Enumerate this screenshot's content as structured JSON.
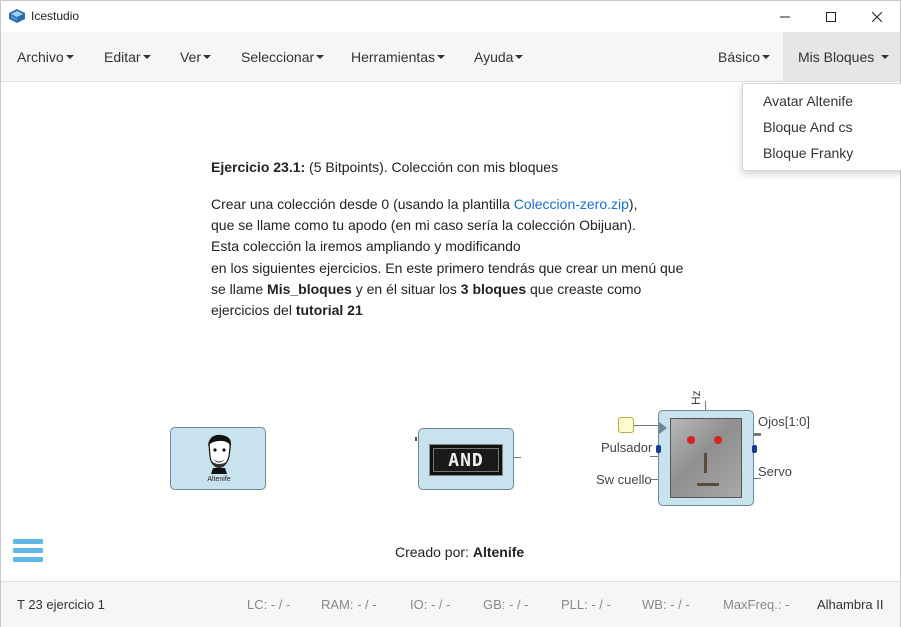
{
  "window": {
    "title": "Icestudio",
    "icon": "icestudio-logo-icon"
  },
  "menubar": {
    "items": [
      {
        "label": "Archivo"
      },
      {
        "label": "Editar"
      },
      {
        "label": "Ver"
      },
      {
        "label": "Seleccionar"
      },
      {
        "label": "Herramientas"
      },
      {
        "label": "Ayuda"
      }
    ],
    "right_items": [
      {
        "label": "Básico"
      },
      {
        "label": "Mis Bloques"
      }
    ]
  },
  "dropdown": {
    "items": [
      {
        "label": "Avatar Altenife"
      },
      {
        "label": "Bloque And cs"
      },
      {
        "label": "Bloque Franky"
      }
    ]
  },
  "content": {
    "heading_bold": "Ejercicio 23.1:",
    "heading_rest": " (5 Bitpoints). Colección con mis bloques",
    "line1_a": "Crear una colección desde 0 (usando la plantilla ",
    "line1_link": "Coleccion-zero.zip",
    "line1_b": "),",
    "line2": "que se llame como tu apodo (en mi caso sería la colección Obijuan).",
    "line3": "Esta colección la iremos ampliando y modificando",
    "line4": "en los siguientes ejercicios. En este primero tendrás que crear un menú que",
    "line5_a": "se llame ",
    "line5_b1": "Mis_bloques",
    "line5_c": " y en él situar los ",
    "line5_b2": "3 bloques",
    "line5_d": " que creaste como",
    "line6_a": "ejercicios del ",
    "line6_b": "tutorial 21",
    "blocks": {
      "avatar_caption": "Altenife",
      "and_label": "AND",
      "franky_top": "Hz",
      "franky_in1": "Pulsador",
      "franky_in2": "Sw cuello",
      "franky_out1": "Ojos[1:0]",
      "franky_out2": "Servo"
    },
    "credit_prefix": "Creado por: ",
    "credit_name": "Altenife"
  },
  "statusbar": {
    "project": "T 23 ejercicio 1",
    "lc": "LC:  - / -",
    "ram": "RAM:  - / -",
    "io": "IO:  - / -",
    "gb": "GB:  - / -",
    "pll": "PLL:  - / -",
    "wb": "WB:  - / -",
    "maxfreq": "MaxFreq.:  -",
    "board": "Alhambra II"
  },
  "colors": {
    "accent": "#5fb8e8",
    "link": "#1a6fcf",
    "block_fill": "#c9e3ee"
  }
}
